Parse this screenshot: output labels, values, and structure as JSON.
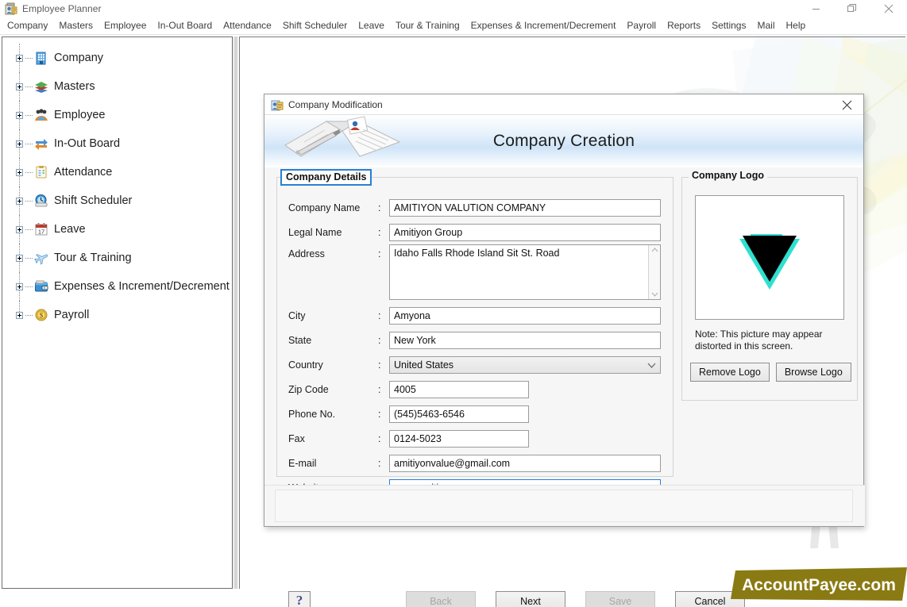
{
  "window": {
    "title": "Employee Planner",
    "icon": "employee-planner-icon",
    "controls": {
      "minimize": "minimize-icon",
      "restore": "restore-icon",
      "close": "close-icon"
    }
  },
  "menubar": {
    "items": [
      "Company",
      "Masters",
      "Employee",
      "In-Out Board",
      "Attendance",
      "Shift Scheduler",
      "Leave",
      "Tour & Training",
      "Expenses & Increment/Decrement",
      "Payroll",
      "Reports",
      "Settings",
      "Mail",
      "Help"
    ]
  },
  "sidebar": {
    "items": [
      {
        "label": "Company",
        "icon": "building-icon",
        "expander": "plus"
      },
      {
        "label": "Masters",
        "icon": "layers-icon",
        "expander": "plus"
      },
      {
        "label": "Employee",
        "icon": "people-icon",
        "expander": "plus"
      },
      {
        "label": "In-Out Board",
        "icon": "in-out-arrows-icon",
        "expander": "plus"
      },
      {
        "label": "Attendance",
        "icon": "clipboard-icon",
        "expander": "plus"
      },
      {
        "label": "Shift Scheduler",
        "icon": "clock-icon",
        "expander": "plus"
      },
      {
        "label": "Leave",
        "icon": "calendar-17-icon",
        "expander": "plus"
      },
      {
        "label": "Tour & Training",
        "icon": "airplane-icon",
        "expander": "plus"
      },
      {
        "label": "Expenses & Increment/Decrement",
        "icon": "wallet-icon",
        "expander": "plus"
      },
      {
        "label": "Payroll",
        "icon": "coin-dollar-icon",
        "expander": "plus"
      }
    ]
  },
  "dialog": {
    "titlebar": {
      "title": "Company Modification",
      "icon": "company-modification-icon",
      "close": "close-icon"
    },
    "banner": {
      "heading": "Company Creation",
      "image": "open-book-with-pen-icon"
    },
    "details": {
      "legend": "Company Details",
      "fields": [
        {
          "label": "Company Name",
          "colon": ":",
          "value": "AMITIYON VALUTION COMPANY",
          "type": "text",
          "width": "full",
          "focused": false
        },
        {
          "label": "Legal Name",
          "colon": ":",
          "value": "Amitiyon Group",
          "type": "text",
          "width": "full",
          "focused": false
        },
        {
          "label": "Address",
          "colon": ":",
          "value": "Idaho Falls Rhode Island  Sit St. Road",
          "type": "textarea",
          "width": "full",
          "focused": false
        },
        {
          "label": "City",
          "colon": ":",
          "value": "Amyona",
          "type": "text",
          "width": "full",
          "focused": false
        },
        {
          "label": "State",
          "colon": ":",
          "value": "New York",
          "type": "text",
          "width": "full",
          "focused": false
        },
        {
          "label": "Country",
          "colon": ":",
          "value": "United States",
          "type": "select",
          "width": "full",
          "focused": false
        },
        {
          "label": "Zip Code",
          "colon": ":",
          "value": "4005",
          "type": "text",
          "width": "half",
          "focused": false
        },
        {
          "label": "Phone No.",
          "colon": ":",
          "value": "(545)5463-6546",
          "type": "text",
          "width": "half",
          "focused": false
        },
        {
          "label": "Fax",
          "colon": ":",
          "value": "0124-5023",
          "type": "text",
          "width": "half",
          "focused": false
        },
        {
          "label": "E-mail",
          "colon": ":",
          "value": "amitiyonvalue@gmail.com",
          "type": "text",
          "width": "full",
          "focused": false
        },
        {
          "label": "Website",
          "colon": ":",
          "value": "www.amitiyon.com",
          "type": "text",
          "width": "full",
          "focused": true
        }
      ]
    },
    "logo": {
      "legend": "Company Logo",
      "image": "black-triangle-with-cyan-shadow-logo",
      "note": "Note: This picture may appear distorted in this screen.",
      "remove_label": "Remove Logo",
      "browse_label": "Browse Logo"
    },
    "footer": {
      "help": "help-question-icon",
      "buttons": [
        {
          "label": "Back",
          "disabled": true
        },
        {
          "label": "Next",
          "disabled": false
        },
        {
          "label": "Save",
          "disabled": true
        },
        {
          "label": "Cancel",
          "disabled": false
        }
      ]
    }
  },
  "watermark": {
    "text": "AccountPayee.com",
    "color": "#8a7a13"
  },
  "colors": {
    "accent_blue": "#2a7fd4",
    "banner_blue": "#cfe4f8",
    "logo_cyan": "#2fe0cf",
    "window_bg": "#ffffff",
    "dialog_bg": "#f6f6f6"
  }
}
